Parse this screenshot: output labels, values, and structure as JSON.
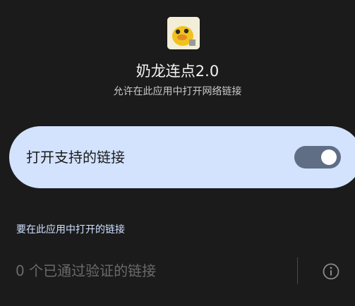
{
  "app": {
    "name": "奶龙连点2.0",
    "subtitle": "允许在此应用中打开网络链接"
  },
  "toggle": {
    "label": "打开支持的链接",
    "state": "on",
    "track_color": "#5f6d85",
    "card_color": "#d3e3fd"
  },
  "links_section": {
    "header": "要在此应用中打开的链接",
    "verified_links_text": "0 个已通过验证的链接"
  },
  "icons": {
    "app_icon": "app-icon-yellow-dragon",
    "info": "info-icon"
  },
  "colors": {
    "background": "#1b1b1b",
    "accent_text": "#cfe0ff"
  }
}
